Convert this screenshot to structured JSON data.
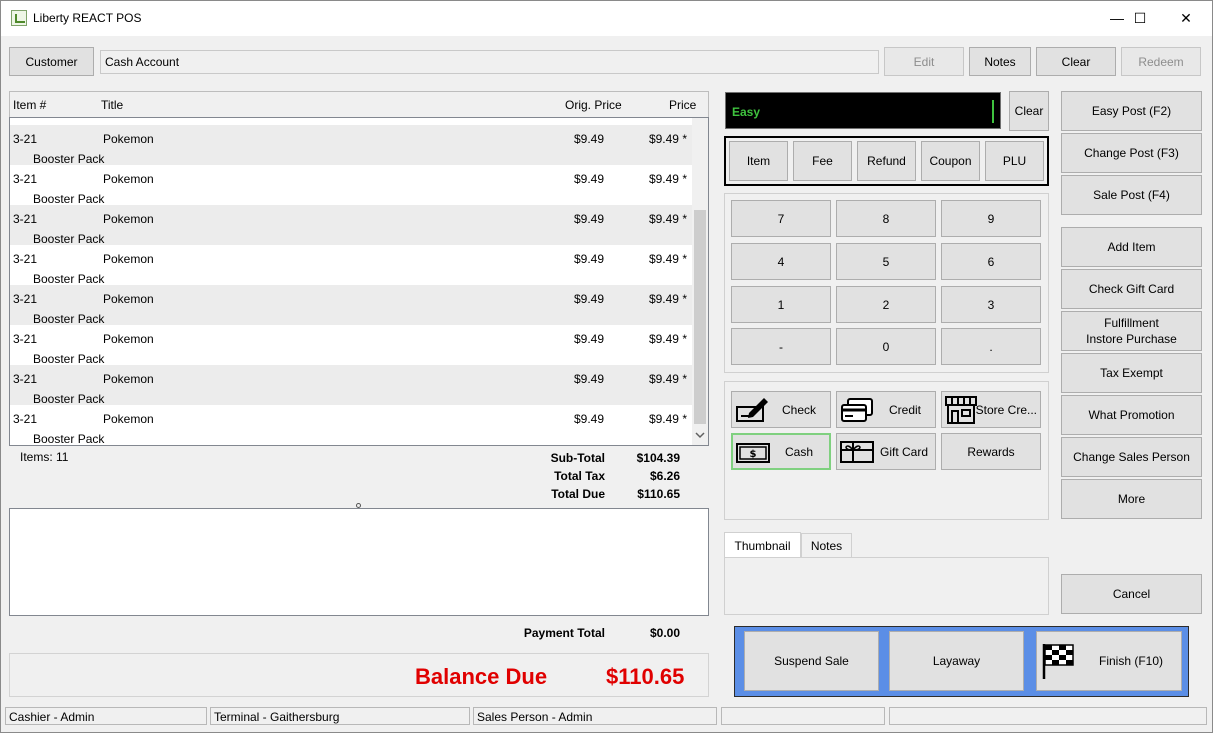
{
  "window": {
    "title": "Liberty REACT POS",
    "minimize": "—",
    "maximize": "☐",
    "close": "✕"
  },
  "top_bar": {
    "customer_button": "Customer",
    "customer_field": "Cash Account",
    "edit": "Edit",
    "notes": "Notes",
    "clear": "Clear",
    "redeem": "Redeem"
  },
  "grid": {
    "columns": [
      "Item #",
      "Title",
      "Orig. Price",
      "Price"
    ],
    "rows": [
      {
        "item": "3-21",
        "title": "Pokemon",
        "desc": "Booster Pack",
        "orig": "$9.49",
        "price": "$9.49 *"
      },
      {
        "item": "3-21",
        "title": "Pokemon",
        "desc": "Booster Pack",
        "orig": "$9.49",
        "price": "$9.49 *"
      },
      {
        "item": "3-21",
        "title": "Pokemon",
        "desc": "Booster Pack",
        "orig": "$9.49",
        "price": "$9.49 *"
      },
      {
        "item": "3-21",
        "title": "Pokemon",
        "desc": "Booster Pack",
        "orig": "$9.49",
        "price": "$9.49 *"
      },
      {
        "item": "3-21",
        "title": "Pokemon",
        "desc": "Booster Pack",
        "orig": "$9.49",
        "price": "$9.49 *"
      },
      {
        "item": "3-21",
        "title": "Pokemon",
        "desc": "Booster Pack",
        "orig": "$9.49",
        "price": "$9.49 *"
      },
      {
        "item": "3-21",
        "title": "Pokemon",
        "desc": "Booster Pack",
        "orig": "$9.49",
        "price": "$9.49 *"
      },
      {
        "item": "3-21",
        "title": "Pokemon",
        "desc": "Booster Pack",
        "orig": "$9.49",
        "price": "$9.49 *"
      }
    ]
  },
  "summary": {
    "items_count": "Items: 11",
    "subtotal_label": "Sub-Total",
    "subtotal": "$104.39",
    "tax_label": "Total Tax",
    "tax": "$6.26",
    "due_label": "Total Due",
    "due": "$110.65",
    "payment_total_label": "Payment Total",
    "payment_total": "$0.00",
    "balance_due_label": "Balance Due",
    "balance_due": "$110.65"
  },
  "entry": {
    "mode_text": "Easy",
    "clear": "Clear"
  },
  "entry_types": [
    "Item",
    "Fee",
    "Refund",
    "Coupon",
    "PLU"
  ],
  "keypad": [
    "7",
    "8",
    "9",
    "4",
    "5",
    "6",
    "1",
    "2",
    "3",
    "-",
    "0",
    "."
  ],
  "tenders": {
    "check": "Check",
    "credit": "Credit",
    "store_credit": "Store Cre...",
    "cash": "Cash",
    "gift_card": "Gift Card",
    "rewards": "Rewards"
  },
  "tabs": {
    "thumbnail": "Thumbnail",
    "notes": "Notes"
  },
  "actions": {
    "suspend": "Suspend Sale",
    "layaway": "Layaway",
    "finish": "Finish (F10)"
  },
  "side_buttons": {
    "easy_post": "Easy Post (F2)",
    "change_post": "Change Post (F3)",
    "sale_post": "Sale Post (F4)",
    "add_item": "Add Item",
    "check_gift_card": "Check Gift Card",
    "fulfillment_line1": "Fulfillment",
    "fulfillment_line2": "Instore Purchase",
    "tax_exempt": "Tax Exempt",
    "what_promotion": "What Promotion",
    "change_sales_person": "Change Sales Person",
    "more": "More",
    "cancel": "Cancel"
  },
  "status_bar": {
    "cashier": "Cashier - Admin",
    "terminal": "Terminal - Gaithersburg",
    "sales_person": "Sales Person - Admin"
  },
  "colors": {
    "balance_red": "#e00000",
    "entry_bg": "#000000",
    "entry_text": "#3fc33f",
    "action_panel": "#5b8ee6"
  }
}
